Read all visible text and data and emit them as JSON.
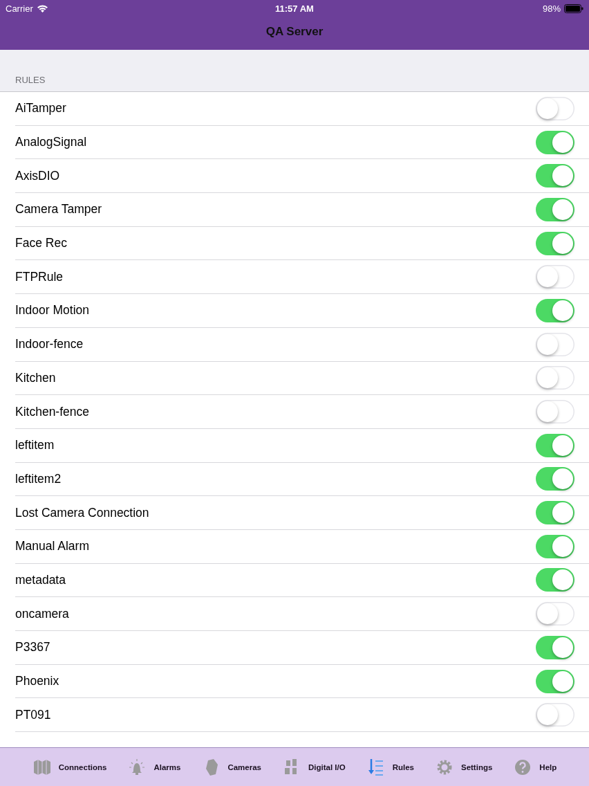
{
  "status_bar": {
    "carrier": "Carrier",
    "time": "11:57 AM",
    "battery": "98%"
  },
  "nav_bar": {
    "title": "QA Server"
  },
  "section": {
    "header": "RULES"
  },
  "rules": [
    {
      "name": "AiTamper",
      "on": false
    },
    {
      "name": "AnalogSignal",
      "on": true
    },
    {
      "name": "AxisDIO",
      "on": true
    },
    {
      "name": "Camera Tamper",
      "on": true
    },
    {
      "name": "Face Rec",
      "on": true
    },
    {
      "name": "FTPRule",
      "on": false
    },
    {
      "name": "Indoor Motion",
      "on": true
    },
    {
      "name": "Indoor-fence",
      "on": false
    },
    {
      "name": "Kitchen",
      "on": false
    },
    {
      "name": "Kitchen-fence",
      "on": false
    },
    {
      "name": "leftitem",
      "on": true
    },
    {
      "name": "leftitem2",
      "on": true
    },
    {
      "name": "Lost Camera Connection",
      "on": true
    },
    {
      "name": "Manual Alarm",
      "on": true
    },
    {
      "name": "metadata",
      "on": true
    },
    {
      "name": "oncamera",
      "on": false
    },
    {
      "name": "P3367",
      "on": true
    },
    {
      "name": "Phoenix",
      "on": true
    },
    {
      "name": "PT091",
      "on": false
    }
  ],
  "tab_bar": [
    {
      "label": "Connections",
      "kind": "connections",
      "selected": false
    },
    {
      "label": "Alarms",
      "kind": "alarms",
      "selected": false
    },
    {
      "label": "Cameras",
      "kind": "cameras",
      "selected": false
    },
    {
      "label": "Digital I/O",
      "kind": "dio",
      "selected": false
    },
    {
      "label": "Rules",
      "kind": "rules",
      "selected": true
    },
    {
      "label": "Settings",
      "kind": "settings",
      "selected": false
    },
    {
      "label": "Help",
      "kind": "help",
      "selected": false
    }
  ]
}
